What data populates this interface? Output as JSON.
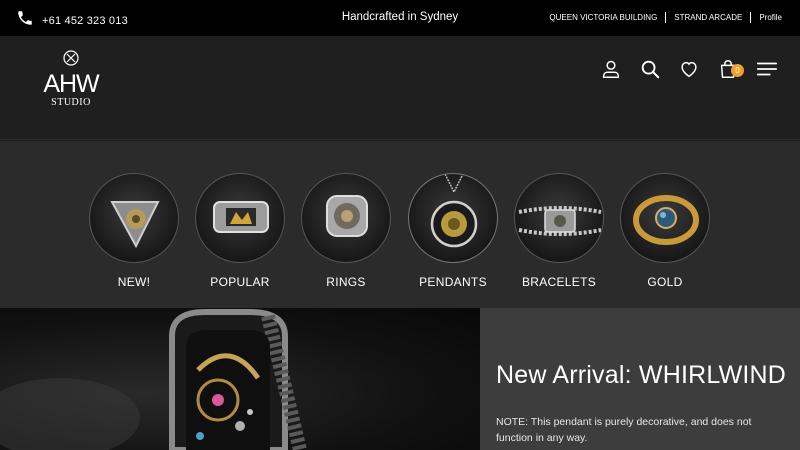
{
  "topbar": {
    "phone_icon": "phone-icon",
    "phone": "+61 452 323 013",
    "tagline": "Handcrafted in Sydney",
    "links": [
      "QUEEN VICTORIA BUILDING",
      "STRAND ARCADE",
      "Profile"
    ]
  },
  "logo": {
    "main": "AHW",
    "sub": "STUDIO"
  },
  "header_icons": {
    "account": "user-icon",
    "search": "search-icon",
    "wishlist": "heart-icon",
    "cart": "bag-icon",
    "cart_count": "0",
    "menu": "hamburger-menu-icon"
  },
  "categories": [
    {
      "label": "NEW!"
    },
    {
      "label": "POPULAR"
    },
    {
      "label": "RINGS"
    },
    {
      "label": "PENDANTS"
    },
    {
      "label": "BRACELETS"
    },
    {
      "label": "GOLD"
    }
  ],
  "hero": {
    "title": "New Arrival: WHIRLWIND",
    "note": "NOTE: This pendant is purely decorative, and does not function in any way."
  },
  "colors": {
    "topbar_bg": "#000000",
    "header_bg": "#1f1f1f",
    "category_bg": "#2b2b2b",
    "hero_panel_bg": "#3d3d3d",
    "accent": "#f2a02c"
  }
}
